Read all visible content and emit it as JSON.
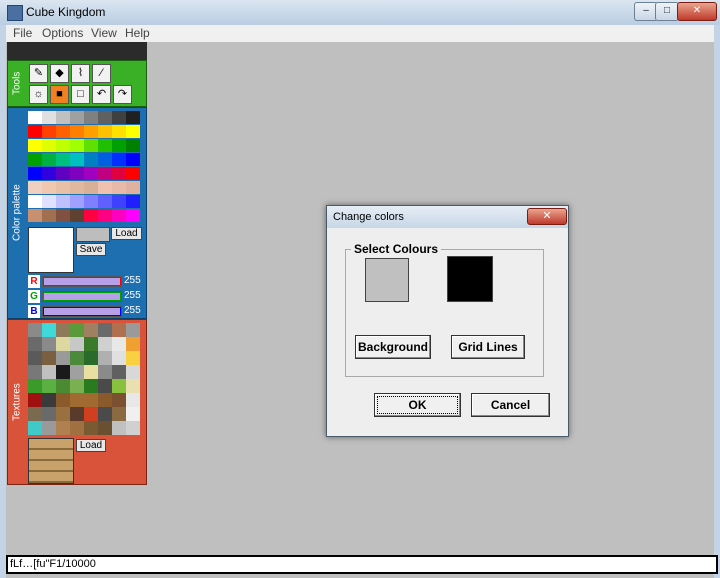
{
  "window": {
    "title": "Cube Kingdom",
    "minimize": "–",
    "maximize": "□",
    "close": "✕"
  },
  "menu": [
    "File",
    "Options",
    "View",
    "Help"
  ],
  "panels": {
    "tools_label": "Tools",
    "palette_label": "Color palette",
    "textures_label": "Textures"
  },
  "palette_buttons": {
    "load": "Load",
    "save": "Save"
  },
  "rgb": [
    {
      "tag": "R",
      "value": "255",
      "color": "#ff0000"
    },
    {
      "tag": "G",
      "value": "255",
      "color": "#00a000"
    },
    {
      "tag": "B",
      "value": "255",
      "color": "#0000ff"
    }
  ],
  "textures_load": "Load",
  "palette_colors": [
    [
      "#ffffff",
      "#e0e0e0",
      "#c0c0c0",
      "#a0a0a0",
      "#808080",
      "#606060",
      "#404040",
      "#202020"
    ],
    [
      "#ff0000",
      "#ff4000",
      "#ff6000",
      "#ff8000",
      "#ffa000",
      "#ffc000",
      "#ffe000",
      "#ffff00"
    ],
    [
      "#ffff00",
      "#e0ff00",
      "#c0ff00",
      "#a0ff00",
      "#60e000",
      "#20c000",
      "#00a000",
      "#008000"
    ],
    [
      "#00a000",
      "#00b040",
      "#00c080",
      "#00c0c0",
      "#0080c0",
      "#0060e0",
      "#0030ff",
      "#0000ff"
    ],
    [
      "#0000ff",
      "#3000e0",
      "#6000c0",
      "#8000c0",
      "#a000c0",
      "#c00080",
      "#e00040",
      "#ff0000"
    ],
    [
      "#f0d0c0",
      "#f0c8b0",
      "#e8c0a8",
      "#e0b8a0",
      "#d8b098",
      "#f0c0b0",
      "#e8b8a8",
      "#e0b0a0"
    ],
    [
      "#ffffff",
      "#e0e0ff",
      "#c0c0ff",
      "#a0a0ff",
      "#8080ff",
      "#6060ff",
      "#4040ff",
      "#2020ff"
    ],
    [
      "#c89070",
      "#a07050",
      "#805040",
      "#604030",
      "#ff0040",
      "#ff0080",
      "#ff00c0",
      "#ff00ff"
    ]
  ],
  "texture_colors": [
    [
      "#8a8a8a",
      "#3fd9d9",
      "#8c7a5a",
      "#5a9a3a",
      "#a08060",
      "#6a6a6a",
      "#b07050",
      "#9a9a9a"
    ],
    [
      "#6a6a6a",
      "#8a8a8a",
      "#dcd8a0",
      "#c8c8c8",
      "#3a7a2a",
      "#d0d0d0",
      "#e8e8e8",
      "#f0a030"
    ],
    [
      "#5a5a5a",
      "#7a6040",
      "#9a9a9a",
      "#4a8a3a",
      "#2a6a2a",
      "#b0b0b0",
      "#e0e0e0",
      "#f8d040"
    ],
    [
      "#787878",
      "#c0c0c0",
      "#1a1a1a",
      "#a0a0a0",
      "#e8e0a0",
      "#8a8a8a",
      "#606060",
      "#d8d8d8"
    ],
    [
      "#3a9a2a",
      "#5ab040",
      "#4a8a30",
      "#7ab050",
      "#2a7a20",
      "#4a4a4a",
      "#8ac040",
      "#e8e0b0"
    ],
    [
      "#a01010",
      "#3a3a3a",
      "#8a5a2a",
      "#a06a30",
      "#a06a30",
      "#8a5a2a",
      "#7a5030",
      "#e8e8e8"
    ],
    [
      "#7a6a50",
      "#6a6a6a",
      "#9a7040",
      "#5a3a2a",
      "#d04020",
      "#4a4a4a",
      "#8a6a40",
      "#f0f0f0"
    ],
    [
      "#3fc9c9",
      "#9a9a9a",
      "#b08050",
      "#a07040",
      "#7a5a30",
      "#6a5030",
      "#c0c0c0",
      "#d0d0d0"
    ]
  ],
  "status": "fLf…[fu\"F1/10000",
  "dialog": {
    "title": "Change colors",
    "close": "✕",
    "group_label": "Select Colours",
    "bg_swatch_color": "#c0c0c0",
    "grid_swatch_color": "#000000",
    "background_btn": "Background",
    "gridlines_btn": "Grid Lines",
    "ok_btn": "OK",
    "cancel_btn": "Cancel"
  }
}
